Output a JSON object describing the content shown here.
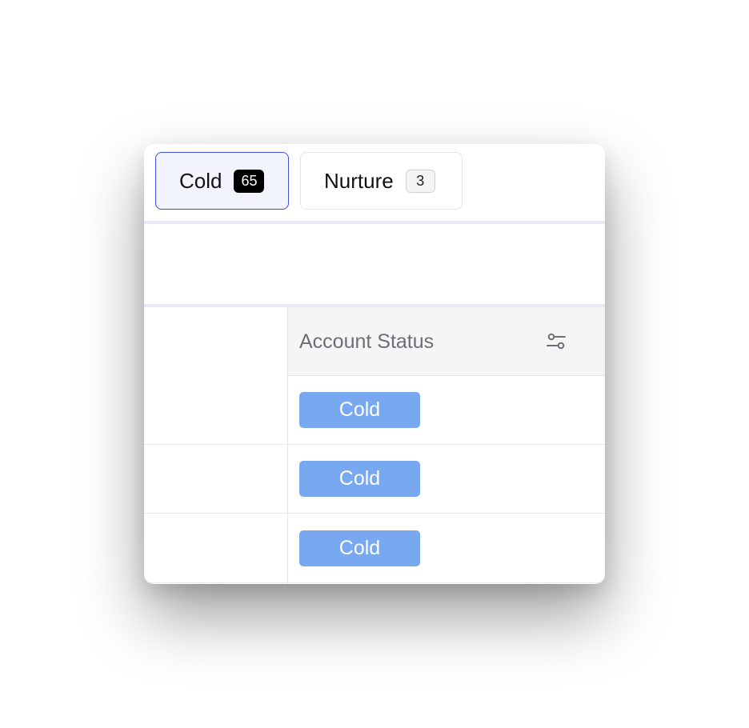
{
  "tabs": [
    {
      "label": "Cold",
      "count": "65",
      "active": true
    },
    {
      "label": "Nurture",
      "count": "3",
      "active": false
    }
  ],
  "table": {
    "columns": [
      {
        "label": ""
      },
      {
        "label": "Account Status",
        "icon": "filter-sliders-icon"
      }
    ],
    "rows": [
      {
        "status": "Cold"
      },
      {
        "status": "Cold"
      },
      {
        "status": "Cold"
      }
    ]
  },
  "colors": {
    "active_tab_border": "#3c4fd3",
    "active_tab_bg": "#f2f4fd",
    "status_chip": "#78a8f0",
    "divider": "#e8e8f6"
  }
}
